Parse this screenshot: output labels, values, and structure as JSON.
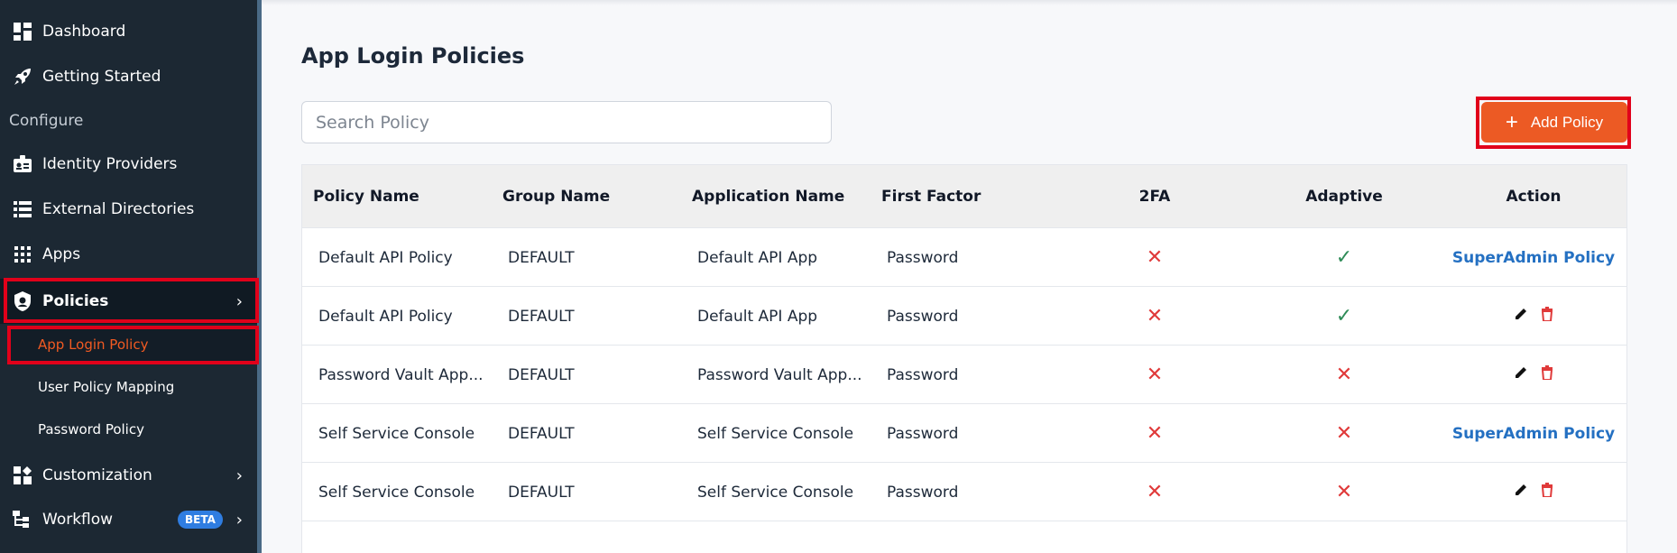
{
  "sidebar": {
    "items": [
      {
        "label": "Dashboard",
        "icon": "dashboard-icon"
      },
      {
        "label": "Getting Started",
        "icon": "rocket-icon"
      },
      {
        "section": "Configure"
      },
      {
        "label": "Identity Providers",
        "icon": "id-badge-icon"
      },
      {
        "label": "External Directories",
        "icon": "list-icon"
      },
      {
        "label": "Apps",
        "icon": "grid-icon"
      },
      {
        "label": "Policies",
        "icon": "shield-icon",
        "expanded": true
      },
      {
        "label": "Customization",
        "icon": "customize-icon"
      },
      {
        "label": "Workflow",
        "icon": "workflow-icon",
        "badge": "BETA"
      }
    ],
    "policy_subitems": [
      "App Login Policy",
      "User Policy Mapping",
      "Password Policy"
    ]
  },
  "main": {
    "title": "App Login Policies",
    "search_placeholder": "Search Policy",
    "add_button_label": "Add Policy",
    "columns": [
      "Policy Name",
      "Group Name",
      "Application Name",
      "First Factor",
      "2FA",
      "Adaptive",
      "Action"
    ],
    "rows": [
      {
        "policy": "Default API Policy",
        "group": "DEFAULT",
        "app": "Default API App",
        "factor": "Password",
        "twofa": false,
        "adaptive": true,
        "action": "SuperAdmin Policy"
      },
      {
        "policy": "Default API Policy",
        "group": "DEFAULT",
        "app": "Default API App",
        "factor": "Password",
        "twofa": false,
        "adaptive": true,
        "action": "edit-delete"
      },
      {
        "policy": "Password Vault App...",
        "group": "DEFAULT",
        "app": "Password Vault App...",
        "factor": "Password",
        "twofa": false,
        "adaptive": false,
        "action": "edit-delete"
      },
      {
        "policy": "Self Service Console",
        "group": "DEFAULT",
        "app": "Self Service Console",
        "factor": "Password",
        "twofa": false,
        "adaptive": false,
        "action": "SuperAdmin Policy"
      },
      {
        "policy": "Self Service Console",
        "group": "DEFAULT",
        "app": "Self Service Console",
        "factor": "Password",
        "twofa": false,
        "adaptive": false,
        "action": "edit-delete"
      }
    ]
  },
  "colors": {
    "sidebar_bg": "#1c2833",
    "accent": "#ec5a24",
    "highlight": "#e1001a",
    "link": "#2470c2",
    "error_x": "#e03a3a",
    "success_check": "#2e8b57",
    "beta_badge": "#2f7de1"
  }
}
